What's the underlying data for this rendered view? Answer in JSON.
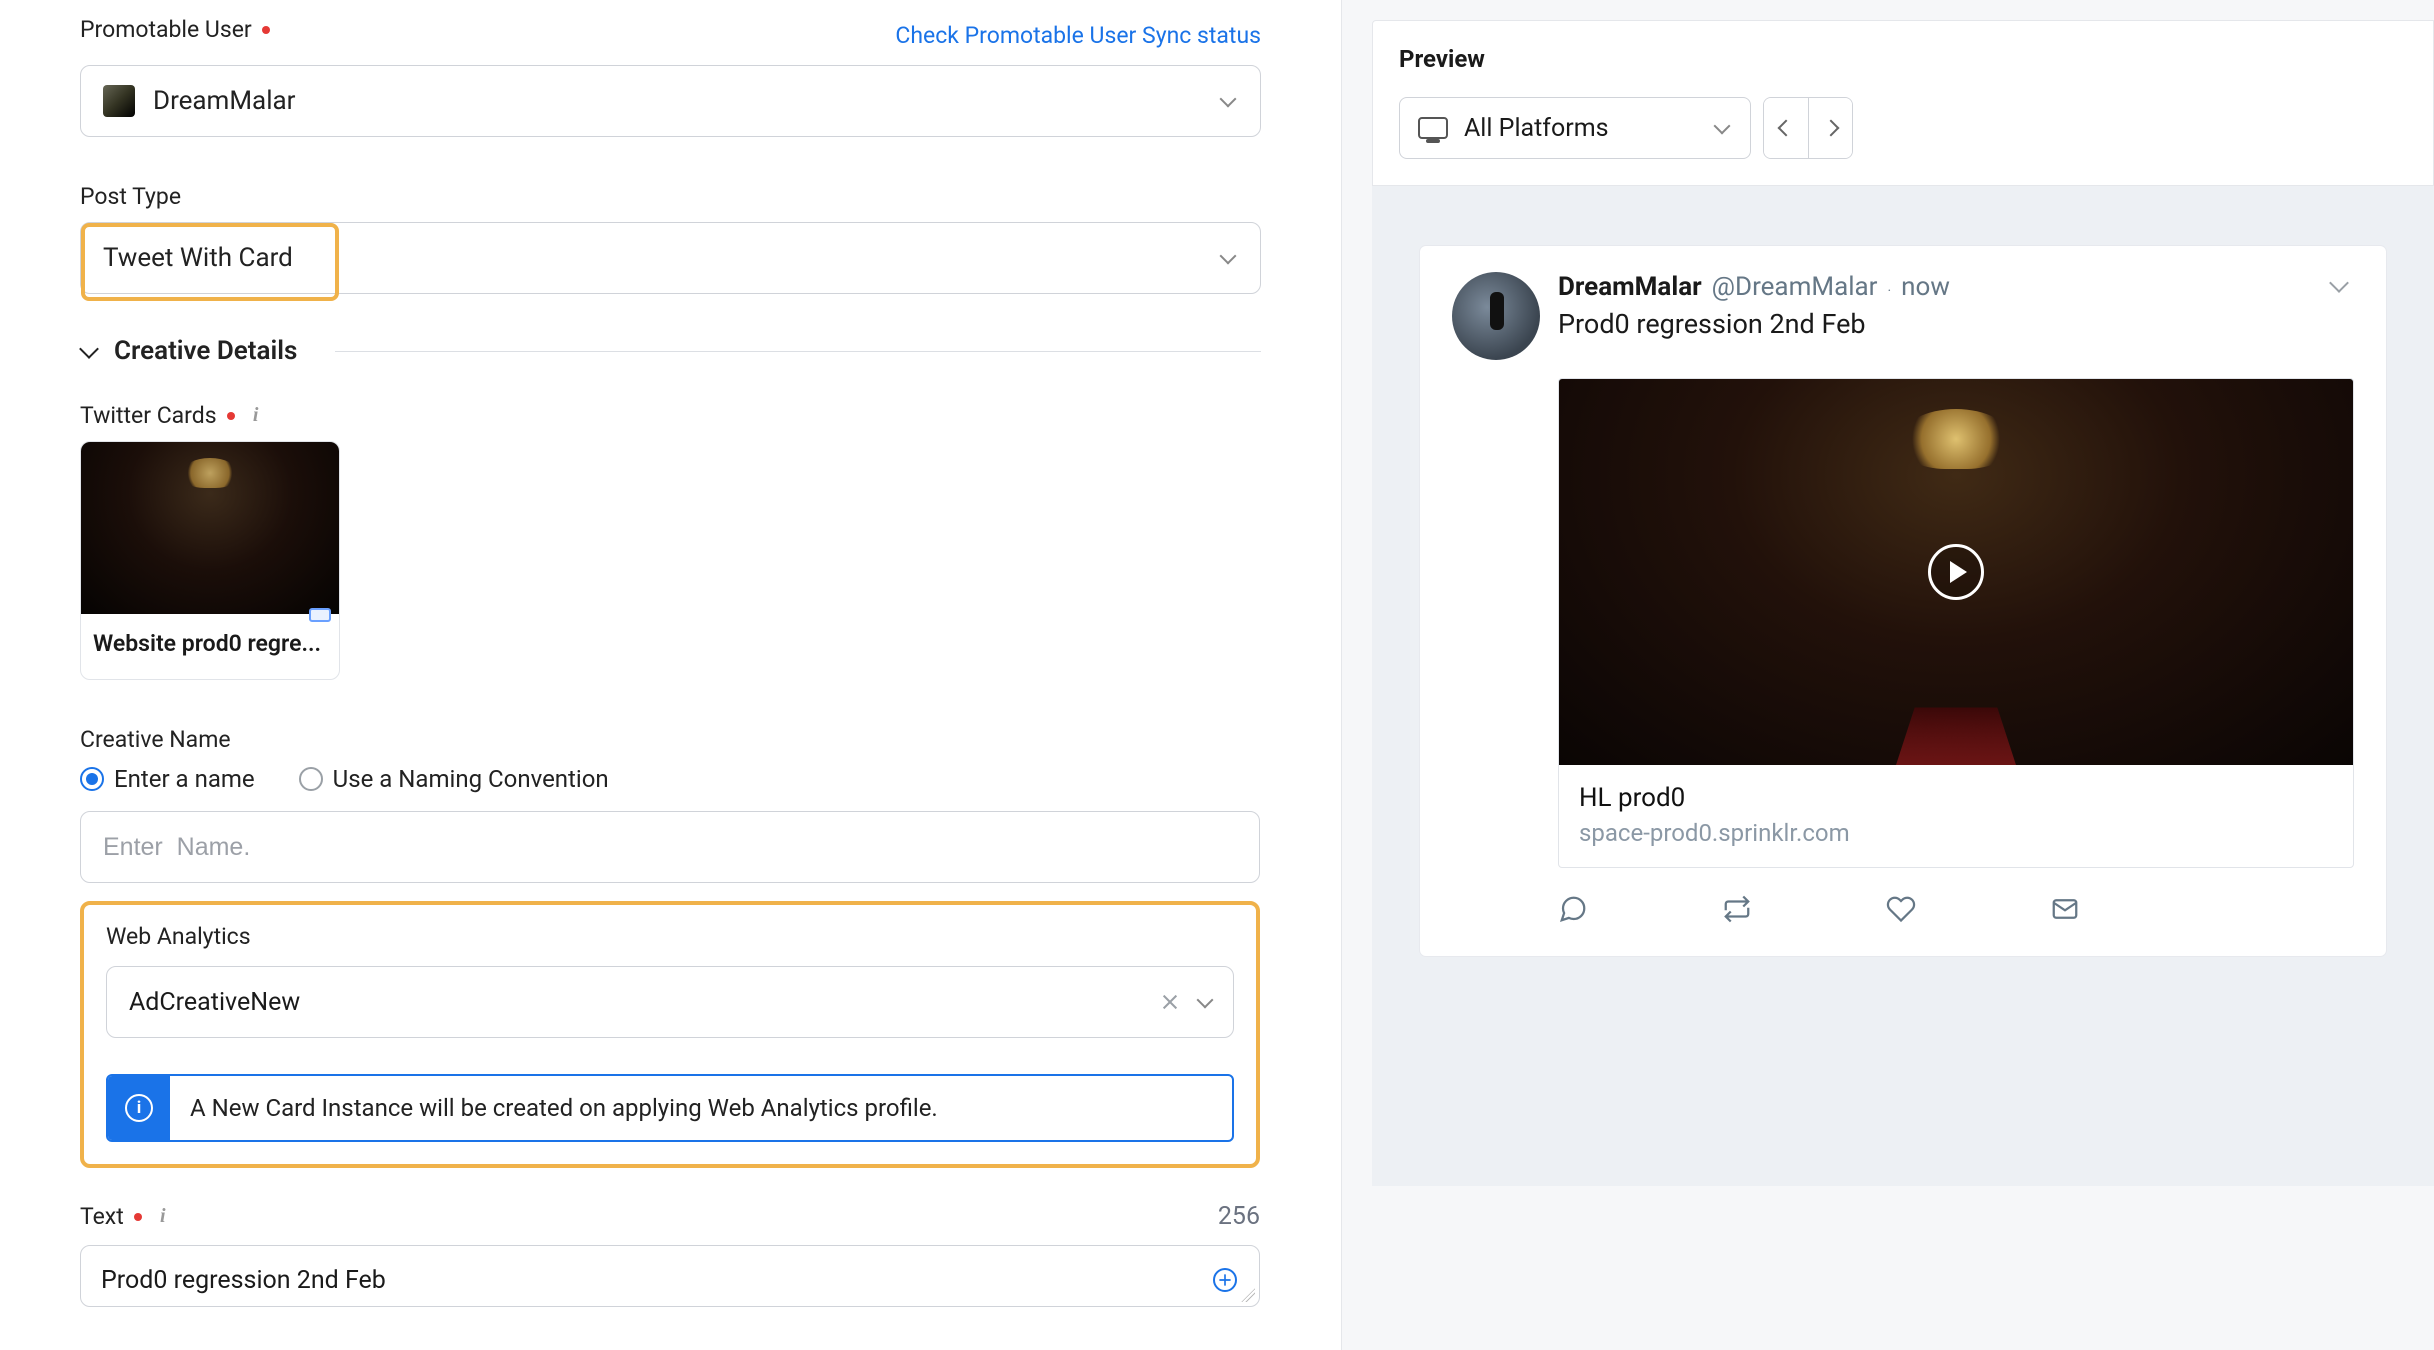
{
  "form": {
    "promotable_user": {
      "label": "Promotable User",
      "sync_link": "Check Promotable User Sync status",
      "value": "DreamMalar"
    },
    "post_type": {
      "label": "Post Type",
      "value": "Tweet With Card"
    },
    "creative_details": {
      "title": "Creative Details",
      "twitter_cards": {
        "label": "Twitter Cards",
        "card_title": "Website prod0 regre..."
      },
      "creative_name": {
        "label": "Creative Name",
        "opt_enter": "Enter a name",
        "opt_convention": "Use a Naming Convention",
        "placeholder": "Enter  Name."
      },
      "web_analytics": {
        "label": "Web Analytics",
        "value": "AdCreativeNew",
        "info": "A New Card Instance will be created on applying Web Analytics profile."
      },
      "text": {
        "label": "Text",
        "count": "256",
        "value": "Prod0 regression 2nd Feb"
      }
    }
  },
  "preview": {
    "title": "Preview",
    "platform_label": "All Platforms",
    "tweet": {
      "name": "DreamMalar",
      "handle": "@DreamMalar",
      "time": "now",
      "body": "Prod0 regression 2nd Feb",
      "card_headline": "HL prod0",
      "card_domain": "space-prod0.sprinklr.com"
    }
  }
}
